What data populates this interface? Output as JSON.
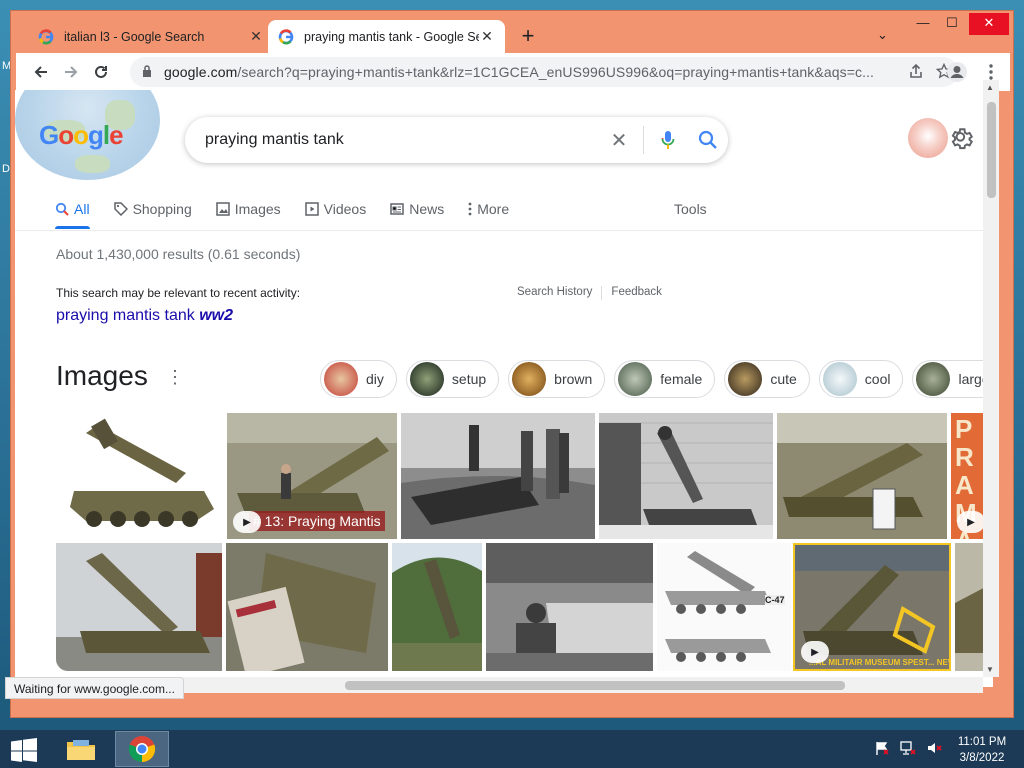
{
  "desktop": {
    "edge_letters": [
      "M",
      "D"
    ]
  },
  "browser": {
    "tabs": [
      {
        "title": "italian l3 - Google Search",
        "active": false
      },
      {
        "title": "praying mantis tank - Google Sea",
        "active": true
      }
    ],
    "new_tab_symbol": "+",
    "tab_search_symbol": "⌄",
    "window_controls": {
      "minimize": "—",
      "maximize": "☐",
      "close": "✕"
    },
    "url_host": "google.com",
    "url_rest": "/search?q=praying+mantis+tank&rlz=1C1GCEA_enUS996US996&oq=praying+mantis+tank&aqs=c...",
    "status_text": "Waiting for www.google.com..."
  },
  "search": {
    "logo_text": "Google",
    "query": "praying mantis tank",
    "nav_tabs": [
      {
        "label": "All",
        "icon": "search-icon",
        "active": true
      },
      {
        "label": "Shopping",
        "icon": "tag-icon",
        "active": false
      },
      {
        "label": "Images",
        "icon": "image-icon",
        "active": false
      },
      {
        "label": "Videos",
        "icon": "play-icon",
        "active": false
      },
      {
        "label": "News",
        "icon": "news-icon",
        "active": false
      },
      {
        "label": "More",
        "icon": "more-vert-icon",
        "active": false
      }
    ],
    "tools_label": "Tools",
    "result_stats": "About 1,430,000 results (0.61 seconds)",
    "relevant_note": "This search may be relevant to recent activity:",
    "search_history_link": "Search History",
    "feedback_link": "Feedback",
    "related_query_main": "praying mantis tank",
    "related_query_bold": "ww2"
  },
  "images": {
    "heading": "Images",
    "chips": [
      {
        "label": "diy",
        "color": "#c9594a"
      },
      {
        "label": "setup",
        "color": "#3f4a3a"
      },
      {
        "label": "brown",
        "color": "#a8732f"
      },
      {
        "label": "female",
        "color": "#7b8c7a"
      },
      {
        "label": "cute",
        "color": "#6a5a3c"
      },
      {
        "label": "cool",
        "color": "#cfe3ea"
      },
      {
        "label": "large",
        "color": "#78806a"
      }
    ],
    "row1_caption": "# 13: Praying Mantis",
    "row1_edge_text": "PRA MA",
    "row2_badge": "C-47",
    "row2_banner": "...AL MILITAIR MUSEUM SPEST... NEW M..."
  },
  "taskbar": {
    "time": "11:01 PM",
    "date": "3/8/2022"
  },
  "colors": {
    "window_frame": "#f1946f",
    "link_blue": "#1a0dab",
    "accent_blue": "#1a73e8",
    "taskbar": "#1c3a55"
  }
}
